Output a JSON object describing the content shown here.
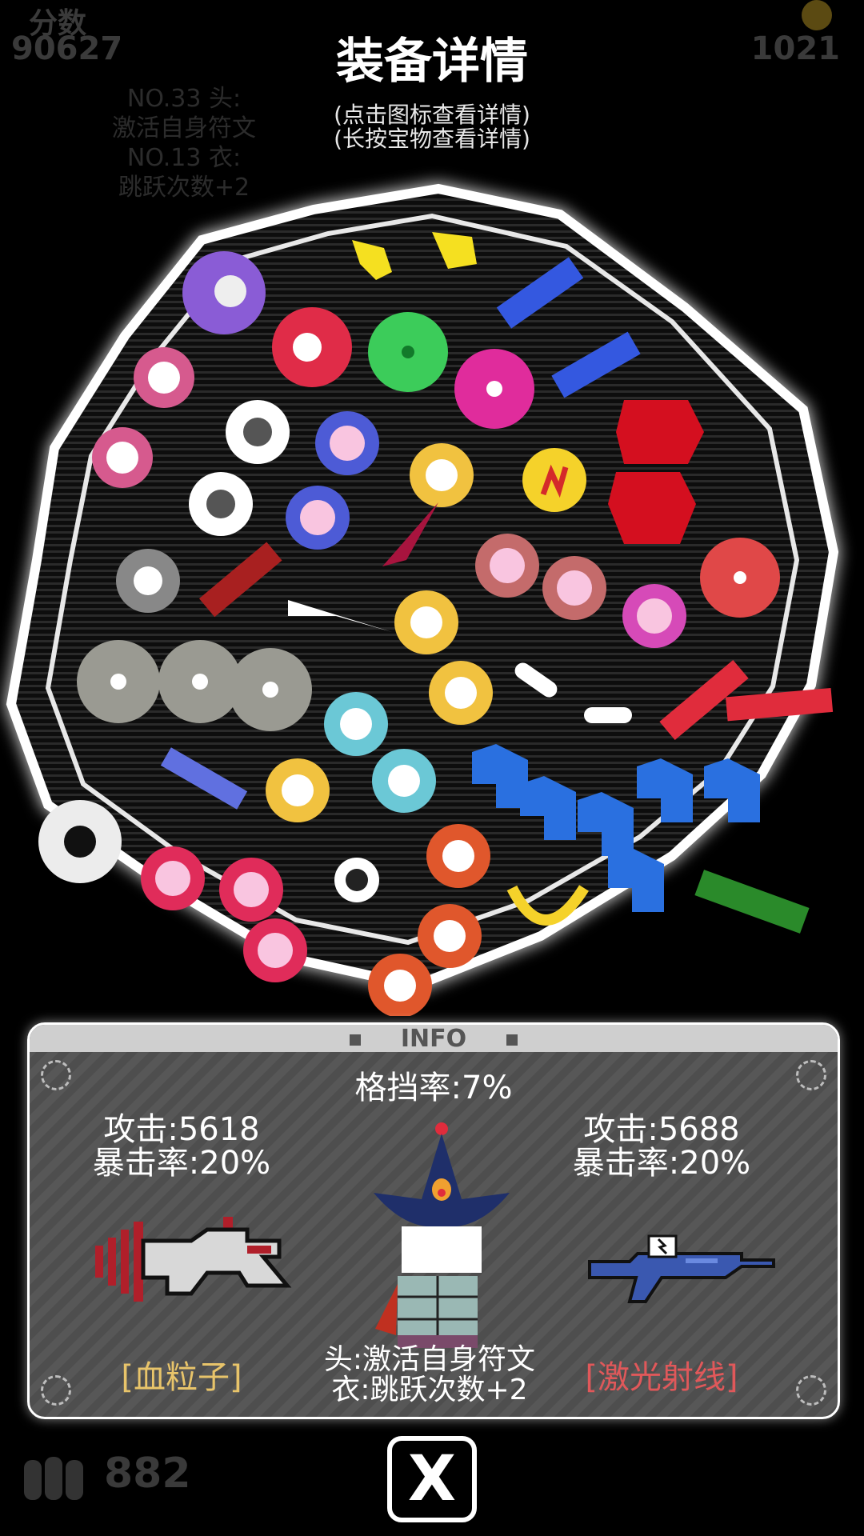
{
  "hud": {
    "score_label": "分数",
    "score_value": "90627",
    "gold_value": "1021",
    "ammo_value": "882",
    "equip_notes": [
      "NO.33 头:",
      "激活自身符文",
      "NO.13 衣:",
      "跳跃次数+2"
    ]
  },
  "header": {
    "title": "装备详情",
    "hint_icon": "(点击图标查看详情)",
    "hint_treasure": "(长按宝物查看详情)"
  },
  "info": {
    "header_label": "INFO",
    "block_rate": "格挡率:7%",
    "left_weapon": {
      "attack": "攻击:5618",
      "crit": "暴击率:20%",
      "name": "[血粒子]",
      "icon": "blood-particle-gun-icon",
      "name_color": "#e8c46a"
    },
    "right_weapon": {
      "attack": "攻击:5688",
      "crit": "暴击率:20%",
      "name": "[激光射线]",
      "icon": "laser-rifle-icon",
      "name_color": "#e0585a"
    },
    "character": {
      "icon": "hat-character-icon",
      "head_note": "头:激活自身符文",
      "body_note": "衣:跳跃次数+2"
    }
  },
  "close_button": {
    "label": "X"
  },
  "colors": {
    "accent": "#ffffff",
    "panel_bg": "#555555"
  }
}
